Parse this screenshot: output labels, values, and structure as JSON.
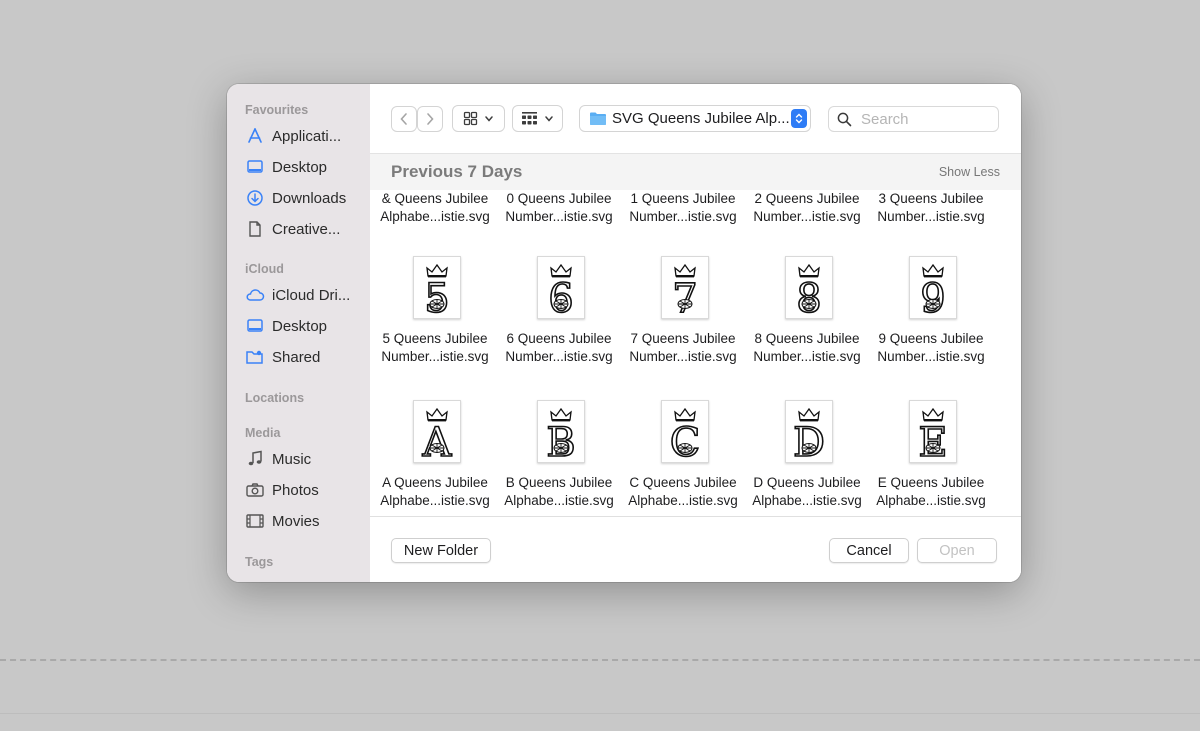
{
  "sidebar": {
    "favourites_title": "Favourites",
    "favourites": [
      {
        "label": "Applicati...",
        "icon": "applications-icon"
      },
      {
        "label": "Desktop",
        "icon": "desktop-icon"
      },
      {
        "label": "Downloads",
        "icon": "downloads-icon"
      },
      {
        "label": "Creative...",
        "icon": "document-icon"
      }
    ],
    "icloud_title": "iCloud",
    "icloud": [
      {
        "label": "iCloud Dri...",
        "icon": "cloud-icon"
      },
      {
        "label": "Desktop",
        "icon": "desktop-icon"
      },
      {
        "label": "Shared",
        "icon": "shared-folder-icon"
      }
    ],
    "locations_title": "Locations",
    "media_title": "Media",
    "media": [
      {
        "label": "Music",
        "icon": "music-note-icon"
      },
      {
        "label": "Photos",
        "icon": "camera-icon"
      },
      {
        "label": "Movies",
        "icon": "film-icon"
      }
    ],
    "tags_title": "Tags"
  },
  "toolbar": {
    "path_label": "SVG Queens Jubilee Alp...",
    "search_placeholder": "Search"
  },
  "group": {
    "title": "Previous 7 Days",
    "toggle_label": "Show Less"
  },
  "files": {
    "row1": [
      {
        "line1": "& Queens Jubilee",
        "line2": "Alphabe...istie.svg"
      },
      {
        "line1": "0 Queens Jubilee",
        "line2": "Number...istie.svg"
      },
      {
        "line1": "1 Queens Jubilee",
        "line2": "Number...istie.svg"
      },
      {
        "line1": "2 Queens Jubilee",
        "line2": "Number...istie.svg"
      },
      {
        "line1": "3 Queens Jubilee",
        "line2": "Number...istie.svg"
      }
    ],
    "row2": [
      {
        "glyph": "5",
        "line1": "5 Queens Jubilee",
        "line2": "Number...istie.svg"
      },
      {
        "glyph": "6",
        "line1": "6 Queens Jubilee",
        "line2": "Number...istie.svg"
      },
      {
        "glyph": "7",
        "line1": "7 Queens Jubilee",
        "line2": "Number...istie.svg"
      },
      {
        "glyph": "8",
        "line1": "8 Queens Jubilee",
        "line2": "Number...istie.svg"
      },
      {
        "glyph": "9",
        "line1": "9 Queens Jubilee",
        "line2": "Number...istie.svg"
      }
    ],
    "row3": [
      {
        "glyph": "A",
        "line1": "A Queens Jubilee",
        "line2": "Alphabe...istie.svg"
      },
      {
        "glyph": "B",
        "line1": "B Queens Jubilee",
        "line2": "Alphabe...istie.svg"
      },
      {
        "glyph": "C",
        "line1": "C Queens Jubilee",
        "line2": "Alphabe...istie.svg"
      },
      {
        "glyph": "D",
        "line1": "D Queens Jubilee",
        "line2": "Alphabe...istie.svg"
      },
      {
        "glyph": "E",
        "line1": "E Queens Jubilee",
        "line2": "Alphabe...istie.svg"
      }
    ]
  },
  "footer": {
    "new_folder_label": "New Folder",
    "cancel_label": "Cancel",
    "open_label": "Open"
  },
  "colors": {
    "accent": "#2e7cf6",
    "sidebar_icon": "#3a82f7",
    "sidebar_bg": "#e8e4e7"
  }
}
